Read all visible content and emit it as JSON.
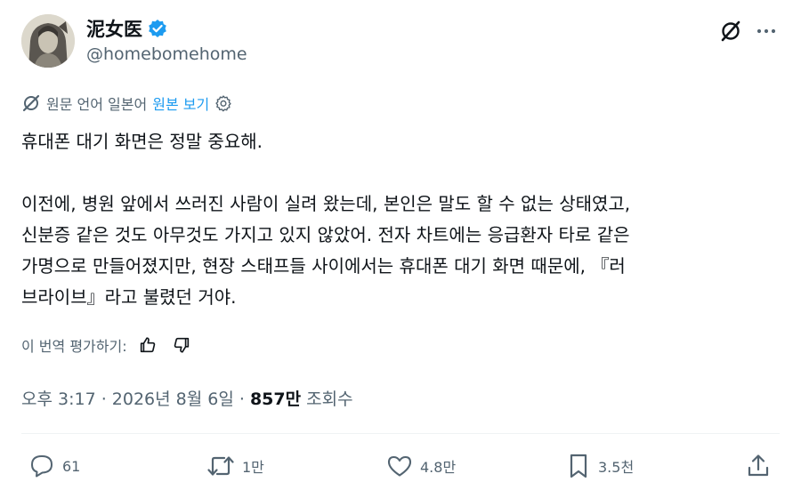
{
  "author": {
    "name": "泥女医",
    "handle": "@homebomehome",
    "verified_color": "#1d9bf0"
  },
  "header": {
    "grok_icon": "grok-icon",
    "more_icon": "more-icon"
  },
  "translation": {
    "source_label": "원문 언어 일본어",
    "view_original": "원본 보기",
    "settings_icon": "gear-icon"
  },
  "post": {
    "lines": [
      "휴대폰 대기 화면은 정말 중요해.",
      "",
      "이전에, 병원 앞에서 쓰러진 사람이 실려 왔는데, 본인은 말도 할 수 없는 상태였고,",
      "신분증 같은 것도 아무것도 가지고 있지 않았어. 전자 차트에는 응급환자 타로 같은",
      "가명으로 만들어졌지만, 현장 스태프들 사이에서는 휴대폰 대기 화면 때문에, 『러",
      "브라이브』라고 불렸던 거야."
    ]
  },
  "rating": {
    "label": "이 번역 평가하기:"
  },
  "meta": {
    "time": "오후 3:17 · 2026년 8월 6일 · ",
    "views_count": "857만",
    "views_label": " 조회수"
  },
  "actions": {
    "replies": "61",
    "reposts": "1만",
    "likes": "4.8만",
    "bookmarks": "3.5천"
  },
  "colors": {
    "text": "#0f1419",
    "secondary": "#536471",
    "accent": "#1d9bf0",
    "divider": "#eff3f4"
  }
}
